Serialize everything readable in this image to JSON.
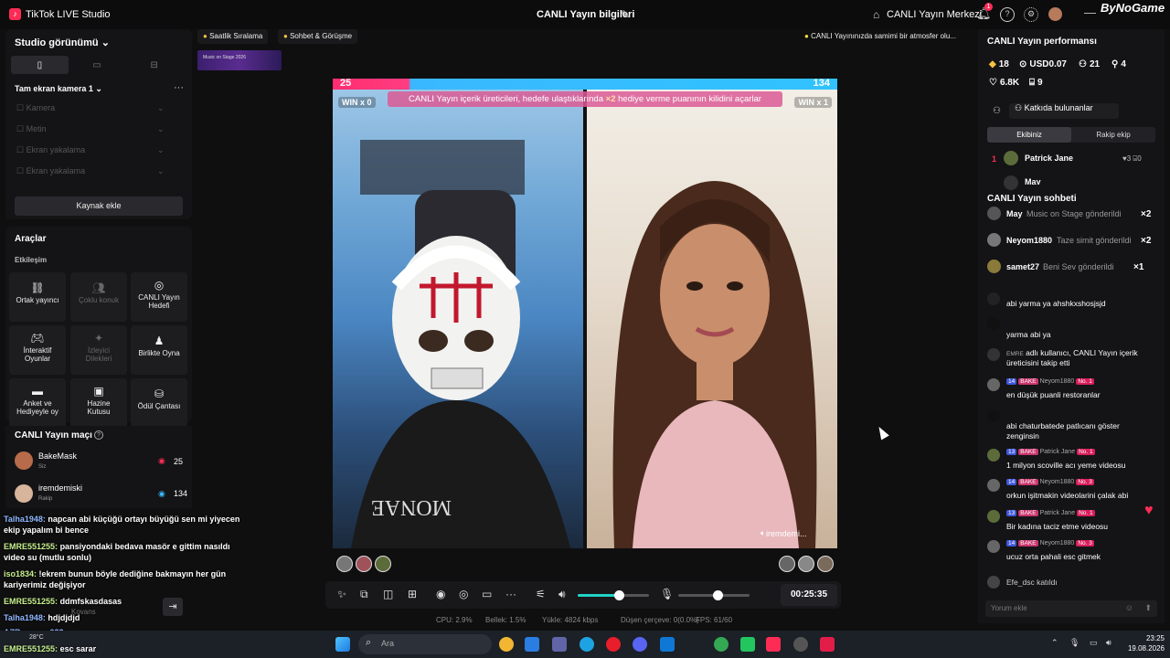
{
  "titlebar": {
    "app_name": "TikTok LIVE Studio",
    "center_title": "CANLI Yayın bilgileri",
    "live_center": "CANLI Yayın Merkezi",
    "notif_count": "1",
    "watermark": "ByNoGame"
  },
  "left": {
    "studio_view": "Studio görünümü",
    "scene": "Tam ekran kamera 1",
    "sources": [
      "Kamera",
      "Metin",
      "Ekran yakalama",
      "Ekran yakalama"
    ],
    "add_source": "Kaynak ekle",
    "tools_title": "Araçlar",
    "tools_section": "Etkileşim",
    "tools": [
      {
        "label1": "Ortak yayıncı",
        "label2": "",
        "icon": "link-icon",
        "glyph": "⛓"
      },
      {
        "label1": "Çoklu konuk",
        "label2": "",
        "icon": "multi-guest-icon",
        "glyph": "👥"
      },
      {
        "label1": "CANLI Yayın",
        "label2": "Hedefi",
        "icon": "goal-icon",
        "glyph": "◎"
      },
      {
        "label1": "İnteraktif",
        "label2": "Oyunlar",
        "icon": "gamepad-icon",
        "glyph": "🎮"
      },
      {
        "label1": "İzleyici",
        "label2": "Dilekleri",
        "icon": "wishes-icon",
        "glyph": "✦"
      },
      {
        "label1": "Birlikte Oyna",
        "label2": "",
        "icon": "play-together-icon",
        "glyph": "♟"
      },
      {
        "label1": "Anket ve",
        "label2": "Hediyeyle oy",
        "icon": "poll-icon",
        "glyph": "▬"
      },
      {
        "label1": "Hazine",
        "label2": "Kutusu",
        "icon": "treasure-icon",
        "glyph": "▣"
      },
      {
        "label1": "Ödül Çantası",
        "label2": "",
        "icon": "reward-bag-icon",
        "glyph": "⛁"
      }
    ],
    "match_title": "CANLI Yayın maçı",
    "match_rows": [
      {
        "name": "BakeMask",
        "sub": "Siz",
        "score": "25",
        "color": "#b86b4a"
      },
      {
        "name": "iremdemiski",
        "sub": "Rakip",
        "score": "134",
        "color": "#d7b59c"
      }
    ],
    "overlay_comments": [
      {
        "user": "Talha1948:",
        "text": "napcan abi küçüğü ortayı büyüğü sen mi yiyecen ekip yapalım bi bence",
        "green": false
      },
      {
        "user": "EMRE551255:",
        "text": "pansiyondaki bedava masör e gittim nasıldı video su (mutlu sonlu)",
        "green": true
      },
      {
        "user": "iso1834:",
        "text": "!ekrem bunun böyle dediğine bakmayın her gün kariyerimiz değişiyor",
        "green": true
      },
      {
        "user": "EMRE551255:",
        "text": "ddmfskasdasas",
        "green": true
      },
      {
        "user": "Talha1948:",
        "text": "hdjdjdjd",
        "green": false
      },
      {
        "user": "AZRgamers033:",
        "text": "",
        "green": false
      },
      {
        "user": "EMRE551255:",
        "text": "esc sarar",
        "green": true
      }
    ],
    "kovans": "Kovans"
  },
  "top_chips": {
    "hourly": "Saatlik Sıralama",
    "chat_meet": "Sohbet & Görüşme",
    "tip": "CANLI Yayınınızda samimi bir atmosfer olu...",
    "thumb_text": "Music on Stage 2026"
  },
  "stage": {
    "score_left": "25",
    "score_right": "134",
    "banner_pre": "CANLI Yayın içerik üreticileri, hedefe ulaştıklarında ",
    "banner_mult": "×2",
    "banner_post": " hediye verme puanının kilidini açarlar",
    "win_left": "WIN x 0",
    "win_right": "WIN x 1",
    "guest_name": "iremdemi...",
    "left_share": 0.157
  },
  "controls": {
    "timer": "00:25:35",
    "volume_level": 0.58,
    "mic_level": 0.55
  },
  "stats": {
    "cpu": "CPU:  2.9%",
    "memory": "Bellek:  1.5%",
    "upload": "Yükle:  4824 kbps",
    "dropped": "Düşen çerçeve:  0(0.0%)",
    "fps": "FPS:  61/60"
  },
  "right": {
    "perf_title": "CANLI Yayın performansı",
    "diamonds": "18",
    "usd": "USD0.07",
    "viewers": "21",
    "followers": "4",
    "likes": "6.8K",
    "gifts": "9",
    "contributors": "Katkıda bulunanlar",
    "team_tab": "Ekibiniz",
    "rival_tab": "Rakip ekip",
    "rank": [
      {
        "num": "1",
        "name": "Patrick Jane",
        "hearts": "3",
        "gifts": "0"
      },
      {
        "num": "2",
        "name": "May",
        "hearts": "",
        "gifts": ""
      }
    ],
    "chat_title": "CANLI Yayın sohbeti",
    "gift_rows": [
      {
        "name": "May",
        "text": "Music on Stage gönderildi",
        "count": "×2",
        "color": "#555"
      },
      {
        "name": "Neyom1880",
        "text": "Taze simit gönderildi",
        "count": "×2",
        "color": "#777"
      },
      {
        "name": "samet27",
        "text": "Beni Sev gönderildi",
        "count": "×1",
        "color": "#8a7b3a"
      }
    ],
    "messages": [
      {
        "meta": "",
        "level": "",
        "fan": "",
        "rank": "",
        "text": "abi yarma ya ahshkxshosjsjd",
        "av": "#222"
      },
      {
        "meta": "",
        "level": "",
        "fan": "",
        "rank": "",
        "text": "yarma abi ya",
        "av": "#111"
      },
      {
        "meta": "",
        "level": "",
        "fan": "",
        "rank": "",
        "text": "adlı kullanıcı, CANLI Yayın içerik",
        "text2": "üreticisini takip etti",
        "av": "#333",
        "special": "EMRE"
      },
      {
        "meta": "Neyom1880",
        "level": "14",
        "fan": "BAKE",
        "rank": "No. 1",
        "text": "en düşük puanli restoranlar",
        "av": "#666"
      },
      {
        "meta": "",
        "level": "",
        "fan": "",
        "rank": "",
        "text": "abi chaturbatede patlıcanı göster",
        "text2": "zenginsin",
        "av": "#111"
      },
      {
        "meta": "Patrick Jane",
        "level": "13",
        "fan": "BAKE",
        "rank": "No. 1",
        "text": "1 milyon scoville acı yeme videosu",
        "av": "#5c6b3a"
      },
      {
        "meta": "Neyom1880",
        "level": "14",
        "fan": "BAKE",
        "rank": "No. 3",
        "text": "orkun işitmakin videolarini çalak abi",
        "av": "#666"
      },
      {
        "meta": "Patrick Jane",
        "level": "13",
        "fan": "BAKE",
        "rank": "No. 1",
        "text": "Bir kadına taciz etme videosu",
        "av": "#5c6b3a"
      },
      {
        "meta": "Neyom1880",
        "level": "14",
        "fan": "BAKE",
        "rank": "No. 3",
        "text": "ucuz orta pahali esc gitmek",
        "av": "#666"
      },
      {
        "meta": "",
        "level": "",
        "fan": "",
        "rank": "",
        "text": "Efe_dsc  katıldı",
        "av": "#444"
      }
    ],
    "chat_placeholder": "Yorum ekle"
  },
  "taskbar": {
    "search": "Ara",
    "temp": "28°C",
    "time": "23:25",
    "date": "19.08.2026"
  },
  "colors": {
    "accent": "#fe2c55",
    "teal": "#21d3c6",
    "panel": "#141416"
  }
}
